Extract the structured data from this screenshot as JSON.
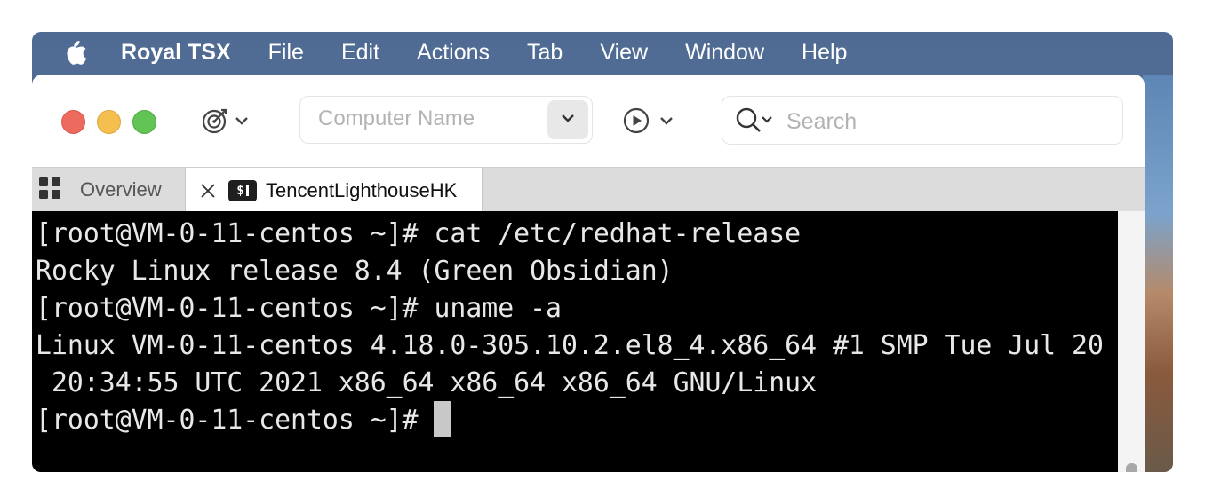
{
  "menubar": {
    "apple_icon": "apple-icon",
    "items": [
      "Royal TSX",
      "File",
      "Edit",
      "Actions",
      "Tab",
      "View",
      "Window",
      "Help"
    ]
  },
  "toolbar": {
    "connect_icon": "target-icon",
    "computer_name_placeholder": "Computer Name",
    "play_icon": "play-icon",
    "search_placeholder": "Search"
  },
  "tabs": [
    {
      "label": "Overview",
      "icon": "grid-icon",
      "active": false
    },
    {
      "label": "TencentLighthouseHK",
      "icon": "terminal-icon",
      "icon_text": "$",
      "active": true
    }
  ],
  "terminal": {
    "lines": [
      "[root@VM-0-11-centos ~]# cat /etc/redhat-release",
      "Rocky Linux release 8.4 (Green Obsidian)",
      "[root@VM-0-11-centos ~]# uname -a",
      "Linux VM-0-11-centos 4.18.0-305.10.2.el8_4.x86_64 #1 SMP Tue Jul 20",
      " 20:34:55 UTC 2021 x86_64 x86_64 x86_64 GNU/Linux",
      "[root@VM-0-11-centos ~]# "
    ]
  },
  "colors": {
    "menubar_bg": "#4f6b93",
    "terminal_bg": "#000000",
    "terminal_fg": "#e8e8e8",
    "close": "#ed6a5e",
    "minimize": "#f5bf4f",
    "zoom": "#61c454"
  }
}
